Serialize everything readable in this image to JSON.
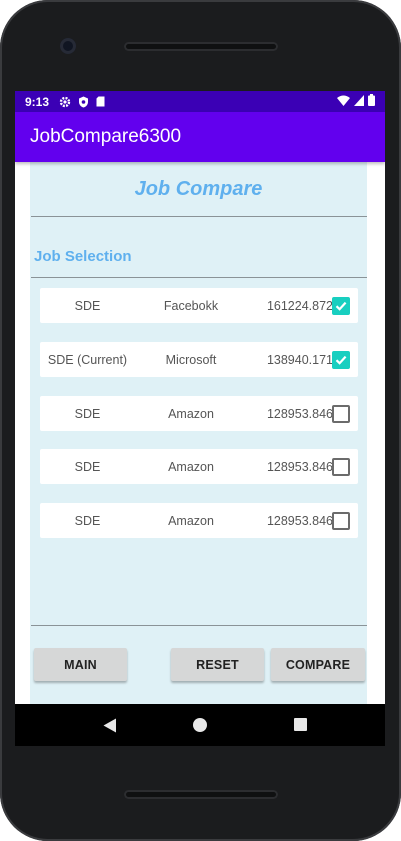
{
  "status_bar": {
    "time": "9:13",
    "icons": [
      "settings-icon",
      "shield-icon",
      "sd-card-icon"
    ],
    "right_icons": [
      "wifi-icon",
      "signal-icon",
      "battery-icon"
    ]
  },
  "app_bar": {
    "title": "JobCompare6300"
  },
  "screen": {
    "title": "Job Compare",
    "section_label": "Job Selection"
  },
  "jobs": [
    {
      "title": "SDE",
      "company": "Facebokk",
      "score": "161224.872",
      "checked": true
    },
    {
      "title": "SDE (Current)",
      "company": "Microsoft",
      "score": "138940.171",
      "checked": true
    },
    {
      "title": "SDE",
      "company": "Amazon",
      "score": "128953.846",
      "checked": false
    },
    {
      "title": "SDE",
      "company": "Amazon",
      "score": "128953.846",
      "checked": false
    },
    {
      "title": "SDE",
      "company": "Amazon",
      "score": "128953.846",
      "checked": false
    }
  ],
  "buttons": {
    "main": "MAIN",
    "reset": "RESET",
    "compare": "COMPARE"
  },
  "nav_bar": {
    "icons": [
      "back-icon",
      "home-icon",
      "recents-icon"
    ]
  },
  "colors": {
    "status_bar": "#3b00b5",
    "app_bar": "#6200ee",
    "content_bg": "#dff1f6",
    "title_text": "#5fb0ee",
    "checkbox_checked": "#18cfc0",
    "button_bg": "#d6d7d7"
  }
}
